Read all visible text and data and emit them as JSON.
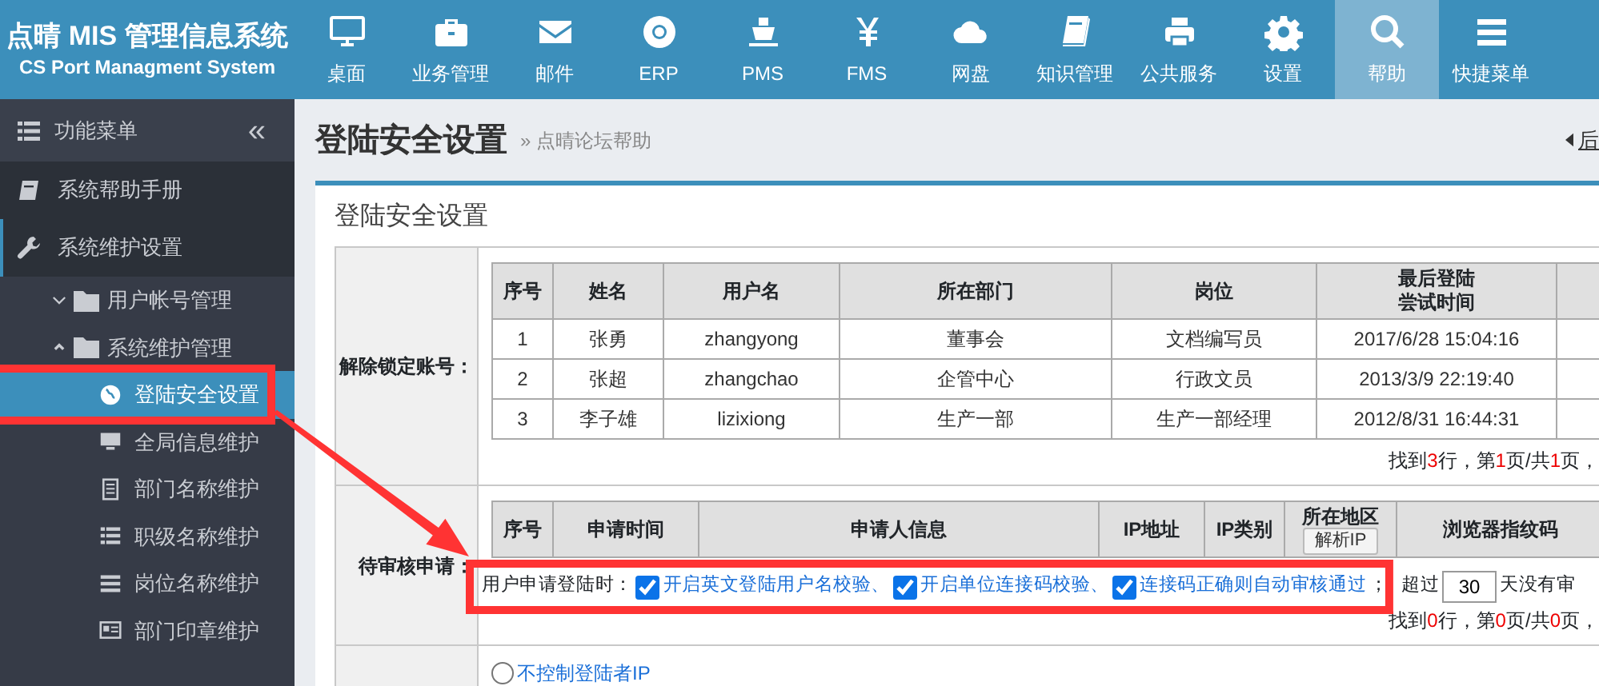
{
  "brand": {
    "title": "点晴 MIS 管理信息系统",
    "subtitle": "CS Port Managment System"
  },
  "nav": [
    {
      "label": "桌面",
      "selected": false
    },
    {
      "label": "业务管理",
      "selected": false
    },
    {
      "label": "邮件",
      "selected": false
    },
    {
      "label": "ERP",
      "selected": false
    },
    {
      "label": "PMS",
      "selected": false
    },
    {
      "label": "FMS",
      "selected": false
    },
    {
      "label": "网盘",
      "selected": false
    },
    {
      "label": "知识管理",
      "selected": false
    },
    {
      "label": "公共服务",
      "selected": false
    },
    {
      "label": "设置",
      "selected": false
    },
    {
      "label": "帮助",
      "selected": true
    },
    {
      "label": "快捷菜单",
      "selected": false
    }
  ],
  "sidebar": {
    "title": "功能菜单",
    "collapse": "«",
    "items": [
      {
        "label": "系统帮助手册",
        "expanded": false
      },
      {
        "label": "系统维护设置",
        "expanded": true,
        "children": [
          {
            "label": "用户帐号管理",
            "expanded": false
          },
          {
            "label": "系统维护管理",
            "expanded": true,
            "children": [
              {
                "label": "登陆安全设置",
                "selected": true,
                "annotated": true
              },
              {
                "label": "全局信息维护",
                "selected": false,
                "annotated": false
              },
              {
                "label": "部门名称维护",
                "selected": false,
                "annotated": false
              },
              {
                "label": "职级名称维护",
                "selected": false,
                "annotated": false
              },
              {
                "label": "岗位名称维护",
                "selected": false,
                "annotated": false
              },
              {
                "label": "部门印章维护",
                "selected": false,
                "annotated": false
              }
            ]
          }
        ]
      }
    ]
  },
  "page": {
    "title": "登陆安全设置",
    "breadcrumb": "» 点晴论坛帮助",
    "back": "后"
  },
  "panel": {
    "title": "登陆安全设置",
    "locked": {
      "label": "解除锁定账号：",
      "columns": [
        "序号",
        "姓名",
        "用户名",
        "所在部门",
        "岗位",
        [
          "最后登陆",
          "尝试时间"
        ]
      ],
      "rows": [
        [
          "1",
          "张勇",
          "zhangyong",
          "董事会",
          "文档编写员",
          "2017/6/28 15:04:16"
        ],
        [
          "2",
          "张超",
          "zhangchao",
          "企管中心",
          "行政文员",
          "2013/3/9 22:19:40"
        ],
        [
          "3",
          "李子雄",
          "lizixiong",
          "生产一部",
          "生产一部经理",
          "2012/8/31 16:44:31"
        ]
      ],
      "pager": [
        {
          "text": "找到",
          "emphasis": false
        },
        {
          "text": "3",
          "emphasis": true
        },
        {
          "text": "行，第",
          "emphasis": false
        },
        {
          "text": "1",
          "emphasis": true
        },
        {
          "text": "页/共",
          "emphasis": false
        },
        {
          "text": "1",
          "emphasis": true
        },
        {
          "text": "页，",
          "emphasis": false
        }
      ]
    },
    "pending": {
      "label": "待审核申请：",
      "columns": [
        "序号",
        "申请时间",
        "申请人信息",
        "IP地址",
        "IP类别",
        "所在地区",
        "浏览器指纹码"
      ],
      "region_button": "解析IP",
      "options": {
        "annotated": true,
        "prefix": "用户申请登陆时：",
        "checks": [
          {
            "label": "开启英文登陆用户名校验、",
            "checked": true
          },
          {
            "label": "开启单位连接码校验、",
            "checked": true
          },
          {
            "label": "连接码正确则自动审核通过",
            "checked": true
          }
        ],
        "separator": "；",
        "days_before": "超过",
        "days": "30",
        "days_after": "天没有审"
      },
      "pager": [
        {
          "text": "找到",
          "emphasis": false
        },
        {
          "text": "0",
          "emphasis": true
        },
        {
          "text": "行，第",
          "emphasis": false
        },
        {
          "text": "0",
          "emphasis": true
        },
        {
          "text": "页/共",
          "emphasis": false
        },
        {
          "text": "0",
          "emphasis": true
        },
        {
          "text": "页，",
          "emphasis": false
        }
      ]
    },
    "ip": {
      "options": [
        {
          "label": "不控制登陆者IP",
          "selected": false
        }
      ]
    }
  }
}
